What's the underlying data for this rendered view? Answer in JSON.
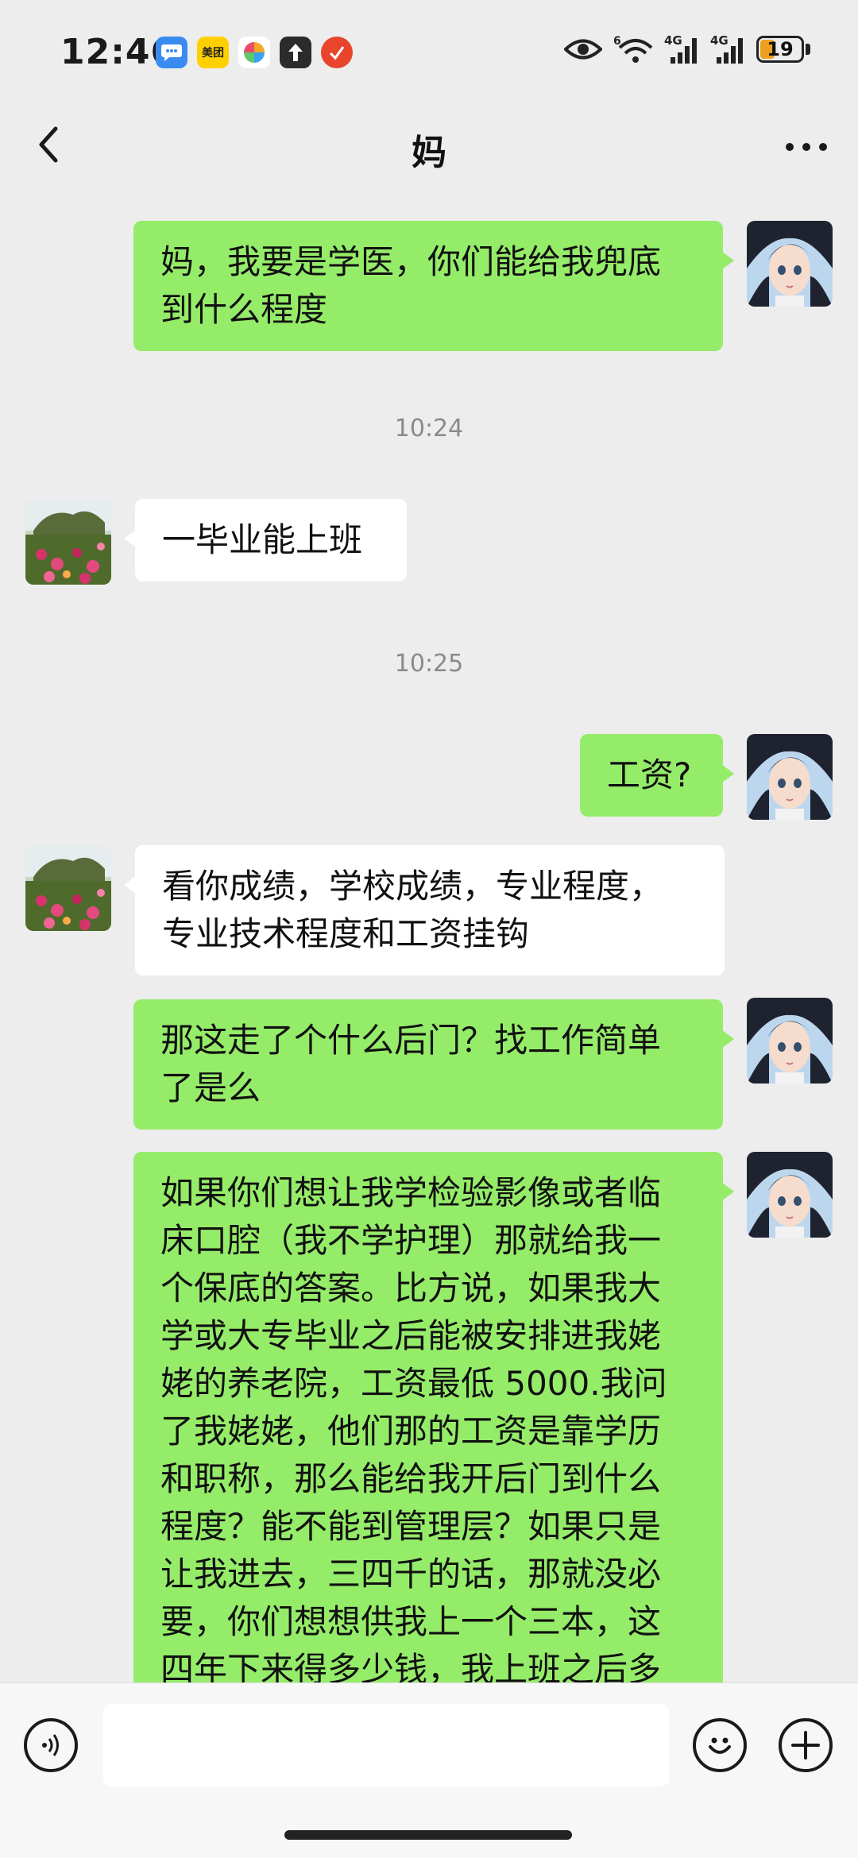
{
  "status_bar": {
    "time": "12:46",
    "app_icons": [
      {
        "name": "message-app-icon",
        "color": "#3a8bf0",
        "glyph": "•••"
      },
      {
        "name": "meituan-app-icon",
        "color": "#ffd000",
        "glyph": "美团"
      },
      {
        "name": "pinwheel-app-icon",
        "color": "#ffffff",
        "glyph": "✿"
      },
      {
        "name": "upload-app-icon",
        "color": "#2b2b2b",
        "glyph": "↑"
      },
      {
        "name": "news-app-icon",
        "color": "#e8452c",
        "glyph": "✓"
      }
    ],
    "network_labels": [
      "6",
      "4G",
      "4G"
    ],
    "battery_level": "19",
    "battery_color": "#f0a020"
  },
  "header": {
    "title": "妈"
  },
  "messages": [
    {
      "sender": "me",
      "lines": [
        "妈，我要是学医，你们能给我兜底",
        "到什么程度"
      ]
    },
    {
      "timestamp": "10:24"
    },
    {
      "sender": "mom",
      "lines": [
        "一毕业能上班"
      ]
    },
    {
      "timestamp": "10:25"
    },
    {
      "sender": "me",
      "lines": [
        "工资?"
      ]
    },
    {
      "sender": "mom",
      "lines": [
        "看你成绩，学校成绩，专业程度，",
        "专业技术程度和工资挂钩"
      ]
    },
    {
      "sender": "me",
      "lines": [
        "那这走了个什么后门？找工作简单",
        "了是么"
      ]
    },
    {
      "sender": "me",
      "lines": [
        "如果你们想让我学检验影像或者临",
        "床口腔（我不学护理）那就给我一",
        "个保底的答案。比方说，如果我大",
        "学或大专毕业之后能被安排进我姥",
        "姥的养老院，工资最低 5000.我问",
        "了我姥姥，他们那的工资是靠学历",
        "和职称，那么能给我开后门到什么",
        "程度？能不能到管理层？如果只是",
        "让我进去，三四千的话，那就没必",
        "要，你们想想供我上一个三本，这",
        "四年下来得多少钱，我上班之后多"
      ]
    }
  ],
  "input_bar": {
    "placeholder": ""
  },
  "colors": {
    "my_bubble": "#95ec69",
    "mom_bubble": "#ffffff",
    "background": "#ededed"
  }
}
